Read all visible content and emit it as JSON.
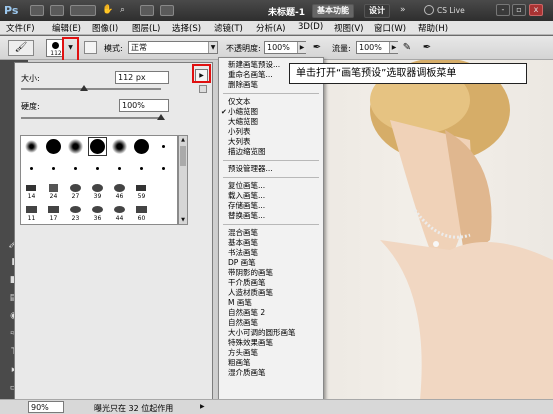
{
  "titlebar": {
    "app_logo": "Ps",
    "doc_title": "未标题-1",
    "workspace_button": "基本功能",
    "design_button": "设计",
    "expand_icon": "»",
    "cs_live": "CS Live",
    "win_min": "-",
    "win_max": "▫",
    "win_close": "x"
  },
  "menubar": {
    "items": [
      "文件(F)",
      "编辑(E)",
      "图像(I)",
      "图层(L)",
      "选择(S)",
      "滤镜(T)",
      "分析(A)",
      "3D(D)",
      "视图(V)",
      "窗口(W)",
      "帮助(H)"
    ]
  },
  "options": {
    "brush_size_badge": "112",
    "mode_label": "模式:",
    "mode_value": "正常",
    "opacity_label": "不透明度:",
    "opacity_value": "100%",
    "flow_label": "流量:",
    "flow_value": "100%"
  },
  "picker": {
    "size_label": "大小:",
    "size_value": "112 px",
    "hardness_label": "硬度:",
    "hardness_value": "100%",
    "size_level": 0.45,
    "hardness_level": 1.0,
    "brush_numbers": [
      "14",
      "24",
      "27",
      "39",
      "46",
      "59",
      "11",
      "17",
      "23",
      "36",
      "44",
      "60"
    ]
  },
  "callout": {
    "text": "单击打开“画笔预设”选取器调板菜单"
  },
  "flyout": {
    "group1": [
      "新建画笔预设...",
      "重命名画笔...",
      "删除画笔"
    ],
    "group2": [
      "仅文本",
      "小缩览图",
      "大缩览图",
      "小列表",
      "大列表",
      "描边缩览图"
    ],
    "checked_item": "小缩览图",
    "group3": [
      "预设管理器..."
    ],
    "group4": [
      "复位画笔...",
      "载入画笔...",
      "存储画笔...",
      "替换画笔..."
    ],
    "group5": [
      "混合画笔",
      "基本画笔",
      "书法画笔",
      "DP 画笔",
      "带阴影的画笔",
      "干介质画笔",
      "人造材质画笔",
      "M 画笔",
      "自然画笔 2",
      "自然画笔",
      "大小可调的圆形画笔",
      "特殊效果画笔",
      "方头画笔",
      "粗画笔",
      "湿介质画笔"
    ]
  },
  "status": {
    "zoom": "90%",
    "info": "曝光只在 32 位起作用"
  },
  "colors": {
    "highlight_red": "#e01010",
    "titlebar_dark": "#2e2e2e"
  }
}
